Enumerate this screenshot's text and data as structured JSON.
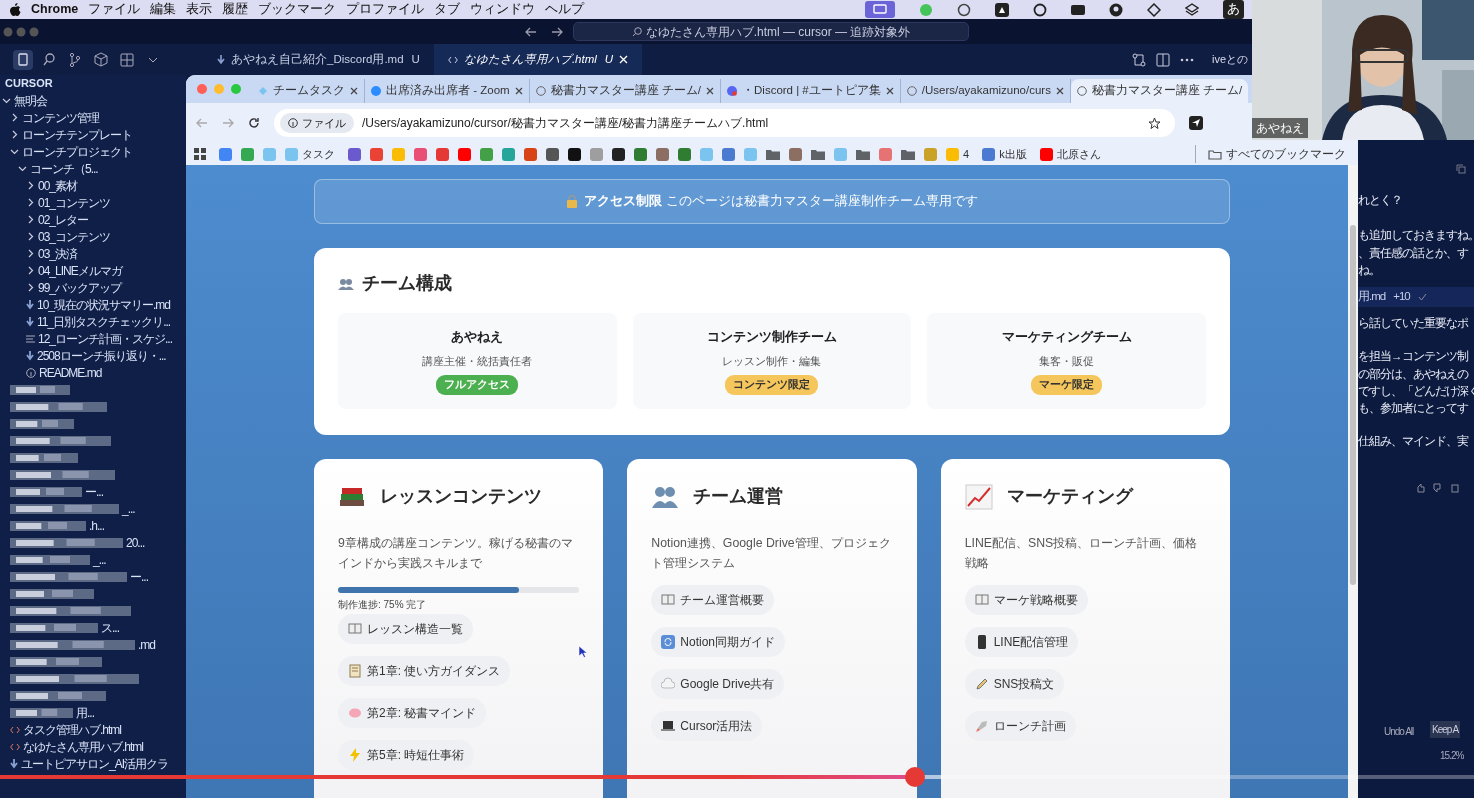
{
  "menubar": {
    "app": "Chrome",
    "menus": [
      "ファイル",
      "編集",
      "表示",
      "履歴",
      "ブックマーク",
      "プロファイル",
      "タブ",
      "ウィンドウ",
      "ヘルプ"
    ],
    "input_label": "あ"
  },
  "editor": {
    "search": "なゆたさん専用ハブ.html — cursor — 追跡対象外",
    "tabs": [
      {
        "label": "あやねえ自己紹介_Discord用.md",
        "badge": "U",
        "selected": false
      },
      {
        "label": "なゆたさん専用ハブ.html",
        "badge": "U",
        "selected": true
      }
    ],
    "cut_tab": "iveとの",
    "explorer": {
      "title": "CURSOR",
      "tree": [
        {
          "label": "無明会",
          "kind": "folder",
          "expanded": true,
          "children": [
            {
              "label": "コンテンツ管理",
              "kind": "folder",
              "expanded": false
            },
            {
              "label": "ローンチテンプレート",
              "kind": "folder",
              "expanded": false
            },
            {
              "label": "ローンチプロジェクト",
              "kind": "folder",
              "expanded": true,
              "children": [
                {
                  "label": "コーンチ（5...",
                  "kind": "folder",
                  "expanded": true,
                  "children": [
                    {
                      "label": "00_素材",
                      "kind": "folder",
                      "expanded": false
                    },
                    {
                      "label": "01_コンテンツ",
                      "kind": "folder",
                      "expanded": false
                    },
                    {
                      "label": "02_レター",
                      "kind": "folder",
                      "expanded": false
                    },
                    {
                      "label": "03_コンテンツ",
                      "kind": "folder",
                      "expanded": false
                    },
                    {
                      "label": "03_決済",
                      "kind": "folder",
                      "expanded": false
                    },
                    {
                      "label": "04_LINEメルマガ",
                      "kind": "folder",
                      "expanded": false
                    },
                    {
                      "label": "99_バックアップ",
                      "kind": "folder",
                      "expanded": false
                    },
                    {
                      "label": "10_現在の状況サマリー.md",
                      "kind": "md"
                    },
                    {
                      "label": "11_日別タスクチェックリ...",
                      "kind": "md"
                    },
                    {
                      "label": "12_ローンチ計画・スケジ...",
                      "kind": "doc"
                    },
                    {
                      "label": "2508ローンチ振り返り・...",
                      "kind": "md"
                    },
                    {
                      "label": "README.md",
                      "kind": "info"
                    }
                  ]
                }
              ]
            },
            {
              "kind": "pixelated"
            },
            {
              "kind": "pixelated"
            },
            {
              "kind": "pixelated"
            },
            {
              "kind": "pixelated"
            },
            {
              "kind": "pixelated"
            },
            {
              "kind": "pixelated"
            },
            {
              "kind": "pixelated",
              "tail": "ー..."
            },
            {
              "kind": "pixelated",
              "tail": "_..."
            },
            {
              "kind": "pixelated",
              "tail": ".h..."
            },
            {
              "kind": "pixelated",
              "tail": "20..."
            },
            {
              "kind": "pixelated",
              "tail": "_..."
            },
            {
              "kind": "pixelated",
              "tail": "ー..."
            },
            {
              "kind": "pixelated"
            },
            {
              "kind": "pixelated"
            },
            {
              "kind": "pixelated",
              "tail": "ス..."
            },
            {
              "kind": "pixelated",
              "tail": ".md"
            },
            {
              "kind": "pixelated"
            },
            {
              "kind": "pixelated"
            },
            {
              "kind": "pixelated"
            },
            {
              "kind": "pixelated",
              "tail": "用..."
            },
            {
              "label": "タスク管理ハブ.html",
              "kind": "html"
            },
            {
              "label": "なゆたさん専用ハブ.html",
              "kind": "html"
            },
            {
              "label": "ユートピアサロン_AI活用クラ",
              "kind": "md"
            }
          ]
        }
      ]
    }
  },
  "chat": {
    "lines": [
      "れとく？",
      "も追加しておきますね。",
      "、責任感の話とか、す",
      "ね。"
    ],
    "file_chip": {
      "name": "用.md",
      "diff": "+10"
    },
    "lines_after": [
      "ら話していた重要なポ",
      "を担当→コンテンツ制",
      "の部分は、あやねえの",
      "ですし、「どんだけ深く",
      "も、参加者にとってす",
      "仕組み、マインド、実"
    ],
    "undo": "Undo All",
    "keep": "Keep A",
    "percent": "15.2%"
  },
  "browser": {
    "tabs": [
      {
        "label": "チームタスク",
        "selected": false
      },
      {
        "label": "出席済み出席者 - Zoom",
        "selected": false
      },
      {
        "label": "秘書力マスター講座 チーム/",
        "selected": false
      },
      {
        "label": "・Discord | #ユートピア集",
        "selected": false
      },
      {
        "label": "/Users/ayakamizuno/curs",
        "selected": false
      },
      {
        "label": "秘書力マスター講座 チーム/",
        "selected": true
      }
    ],
    "url_chip": "ファイル",
    "url": "/Users/ayakamizuno/cursor/秘書力マスター講座/秘書力講座チームハブ.html",
    "bookmarks": [
      {
        "kind": "app",
        "color": "#4285f4"
      },
      {
        "kind": "app",
        "color": "#34a853"
      },
      {
        "kind": "app",
        "color": "#7cc4f0"
      },
      {
        "kind": "app",
        "color": "#7cc4f0",
        "label": "タスク"
      },
      {
        "kind": "app",
        "color": "#6a5acd"
      },
      {
        "kind": "app",
        "color": "#ea4335"
      },
      {
        "kind": "app",
        "color": "#fbbc05"
      },
      {
        "kind": "app",
        "color": "#e94e77"
      },
      {
        "kind": "app",
        "color": "#e53935"
      },
      {
        "kind": "app",
        "color": "#ff0000"
      },
      {
        "kind": "app",
        "color": "#43a047"
      },
      {
        "kind": "app",
        "color": "#26a69a"
      },
      {
        "kind": "app",
        "color": "#d84315"
      },
      {
        "kind": "app",
        "color": "#555555"
      },
      {
        "kind": "app",
        "color": "#111111"
      },
      {
        "kind": "app",
        "color": "#9e9e9e"
      },
      {
        "kind": "app",
        "color": "#222222"
      },
      {
        "kind": "app",
        "color": "#2e7d32"
      },
      {
        "kind": "app",
        "color": "#8d6e63"
      },
      {
        "kind": "app",
        "color": "#2e7d32"
      },
      {
        "kind": "app",
        "color": "#7cc4f0"
      },
      {
        "kind": "app",
        "color": "#4a7bd0"
      },
      {
        "kind": "app",
        "color": "#7cc4f0"
      },
      {
        "kind": "folder",
        "color": "#5f6368"
      },
      {
        "kind": "app",
        "color": "#8d6e63"
      },
      {
        "kind": "folder",
        "color": "#5f6368"
      },
      {
        "kind": "app",
        "color": "#7cc4f0"
      },
      {
        "kind": "folder",
        "color": "#5f6368"
      },
      {
        "kind": "app",
        "color": "#e57373"
      },
      {
        "kind": "folder",
        "color": "#5f6368"
      },
      {
        "kind": "app",
        "color": "#c9a227"
      },
      {
        "kind": "app",
        "color": "#fbbc05",
        "label": "4"
      },
      {
        "kind": "app",
        "color": "#4a7bd0",
        "label": "k出版"
      },
      {
        "kind": "app",
        "color": "#ff0000",
        "label": "北原さん"
      }
    ],
    "all_bookmarks": "すべてのブックマーク",
    "page": {
      "notice": {
        "title": "アクセス制限",
        "text": "このページは秘書力マスター講座制作チーム専用です"
      },
      "team": {
        "title": "チーム構成",
        "members": [
          {
            "name": "あやねえ",
            "role": "講座主催・統括責任者",
            "badge": "フルアクセス",
            "color": "#4caf50"
          },
          {
            "name": "コンテンツ制作チーム",
            "role": "レッスン制作・編集",
            "badge": "コンテンツ限定",
            "color": "#f5c65b"
          },
          {
            "name": "マーケティングチーム",
            "role": "集客・販促",
            "badge": "マーケ限定",
            "color": "#f5c65b"
          }
        ]
      },
      "sections": [
        {
          "title": "レッスンコンテンツ",
          "desc": "9章構成の講座コンテンツ。稼げる秘書のマインドから実践スキルまで",
          "progress": {
            "level": 0.75,
            "label": "制作進捗: 75% 完了"
          },
          "links": [
            "レッスン構造一覧",
            "第1章: 使い方ガイダンス",
            "第2章: 秘書マインド",
            "第5章: 時短仕事術"
          ]
        },
        {
          "title": "チーム運営",
          "desc": "Notion連携、Google Drive管理、プロジェクト管理システム",
          "links": [
            "チーム運営概要",
            "Notion同期ガイド",
            "Google Drive共有",
            "Cursor活用法"
          ]
        },
        {
          "title": "マーケティング",
          "desc": "LINE配信、SNS投稿、ローンチ計画、価格戦略",
          "links": [
            "マーケ戦略概要",
            "LINE配信管理",
            "SNS投稿文",
            "ローンチ計画"
          ]
        }
      ]
    }
  },
  "webcam": {
    "name": "あやねえ"
  },
  "video": {
    "level": 0.621
  }
}
